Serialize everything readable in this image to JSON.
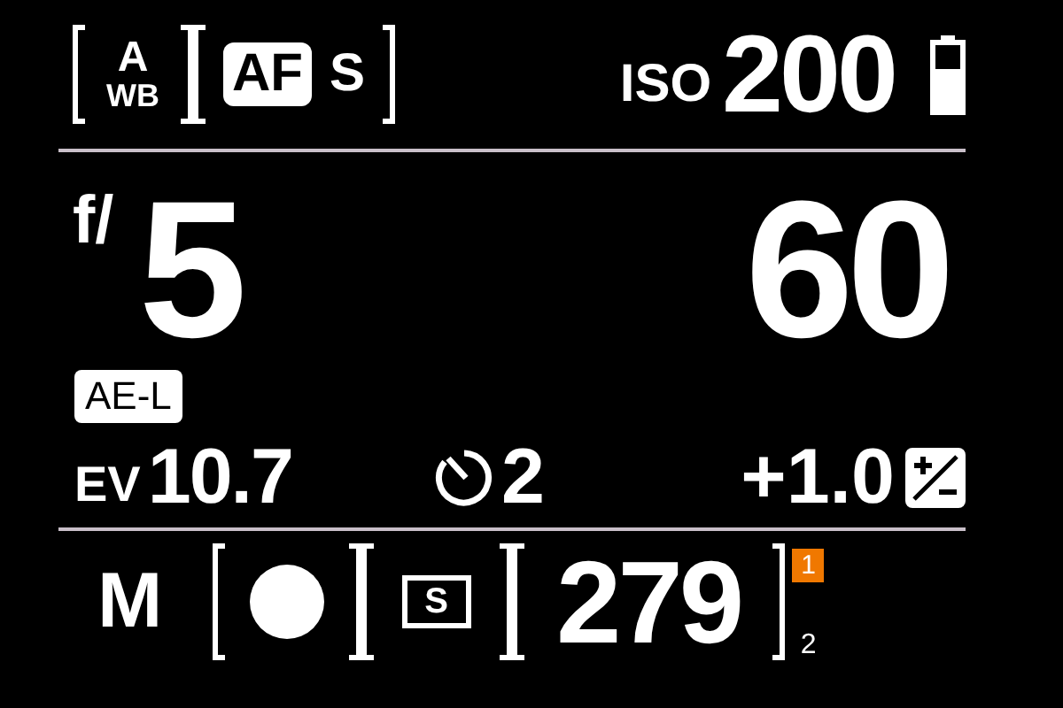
{
  "top": {
    "white_balance": {
      "top": "A",
      "bottom": "WB"
    },
    "focus": {
      "badge": "AF",
      "mode": "S"
    },
    "iso": {
      "label": "ISO",
      "value": "200"
    }
  },
  "exposure": {
    "aperture_prefix": "f/",
    "aperture": "5",
    "shutter": "60"
  },
  "ae_lock": "AE-L",
  "meter": {
    "ev_label": "EV",
    "ev_value": "10.7",
    "self_timer": "2",
    "compensation": "+1.0"
  },
  "bottom": {
    "mode": "M",
    "drive": "S",
    "shots_remaining": "279",
    "card_slot_active": "1",
    "card_slot_other": "2"
  }
}
